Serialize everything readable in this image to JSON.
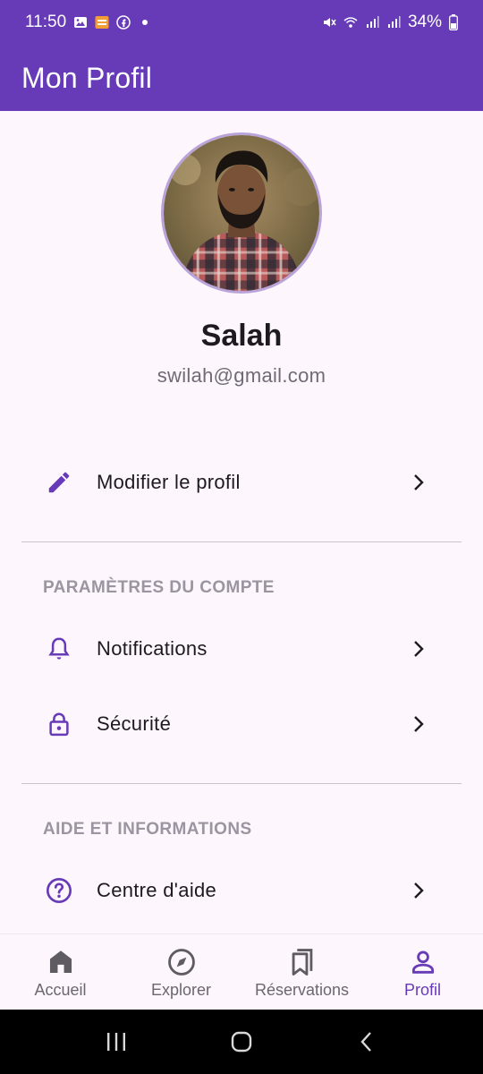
{
  "status_bar": {
    "time": "11:50",
    "battery": "34%",
    "left_icons": [
      "gallery-icon",
      "app-badge-icon",
      "facebook-icon",
      "dot-icon"
    ],
    "right_icons": [
      "mute-icon",
      "wifi-icon",
      "signal-icon",
      "signal-icon",
      "battery-icon"
    ]
  },
  "app_bar": {
    "title": "Mon Profil"
  },
  "profile": {
    "name": "Salah",
    "email": "swilah@gmail.com"
  },
  "menu": {
    "edit_profile": {
      "label": "Modifier le profil",
      "icon": "pencil-icon"
    },
    "account_section": {
      "title": "PARAMÈTRES DU COMPTE",
      "items": [
        {
          "label": "Notifications",
          "icon": "bell-icon"
        },
        {
          "label": "Sécurité",
          "icon": "lock-icon"
        }
      ]
    },
    "help_section": {
      "title": "AIDE ET INFORMATIONS",
      "items": [
        {
          "label": "Centre d'aide",
          "icon": "help-circle-icon"
        }
      ]
    }
  },
  "bottom_nav": {
    "items": [
      {
        "label": "Accueil",
        "icon": "home-icon",
        "active": false
      },
      {
        "label": "Explorer",
        "icon": "compass-icon",
        "active": false
      },
      {
        "label": "Réservations",
        "icon": "bookmarks-icon",
        "active": false
      },
      {
        "label": "Profil",
        "icon": "person-icon",
        "active": true
      }
    ]
  },
  "colors": {
    "primary": "#673ab7",
    "background": "#fdf6fc",
    "text": "#1d1b20",
    "muted": "#6f6a75"
  }
}
